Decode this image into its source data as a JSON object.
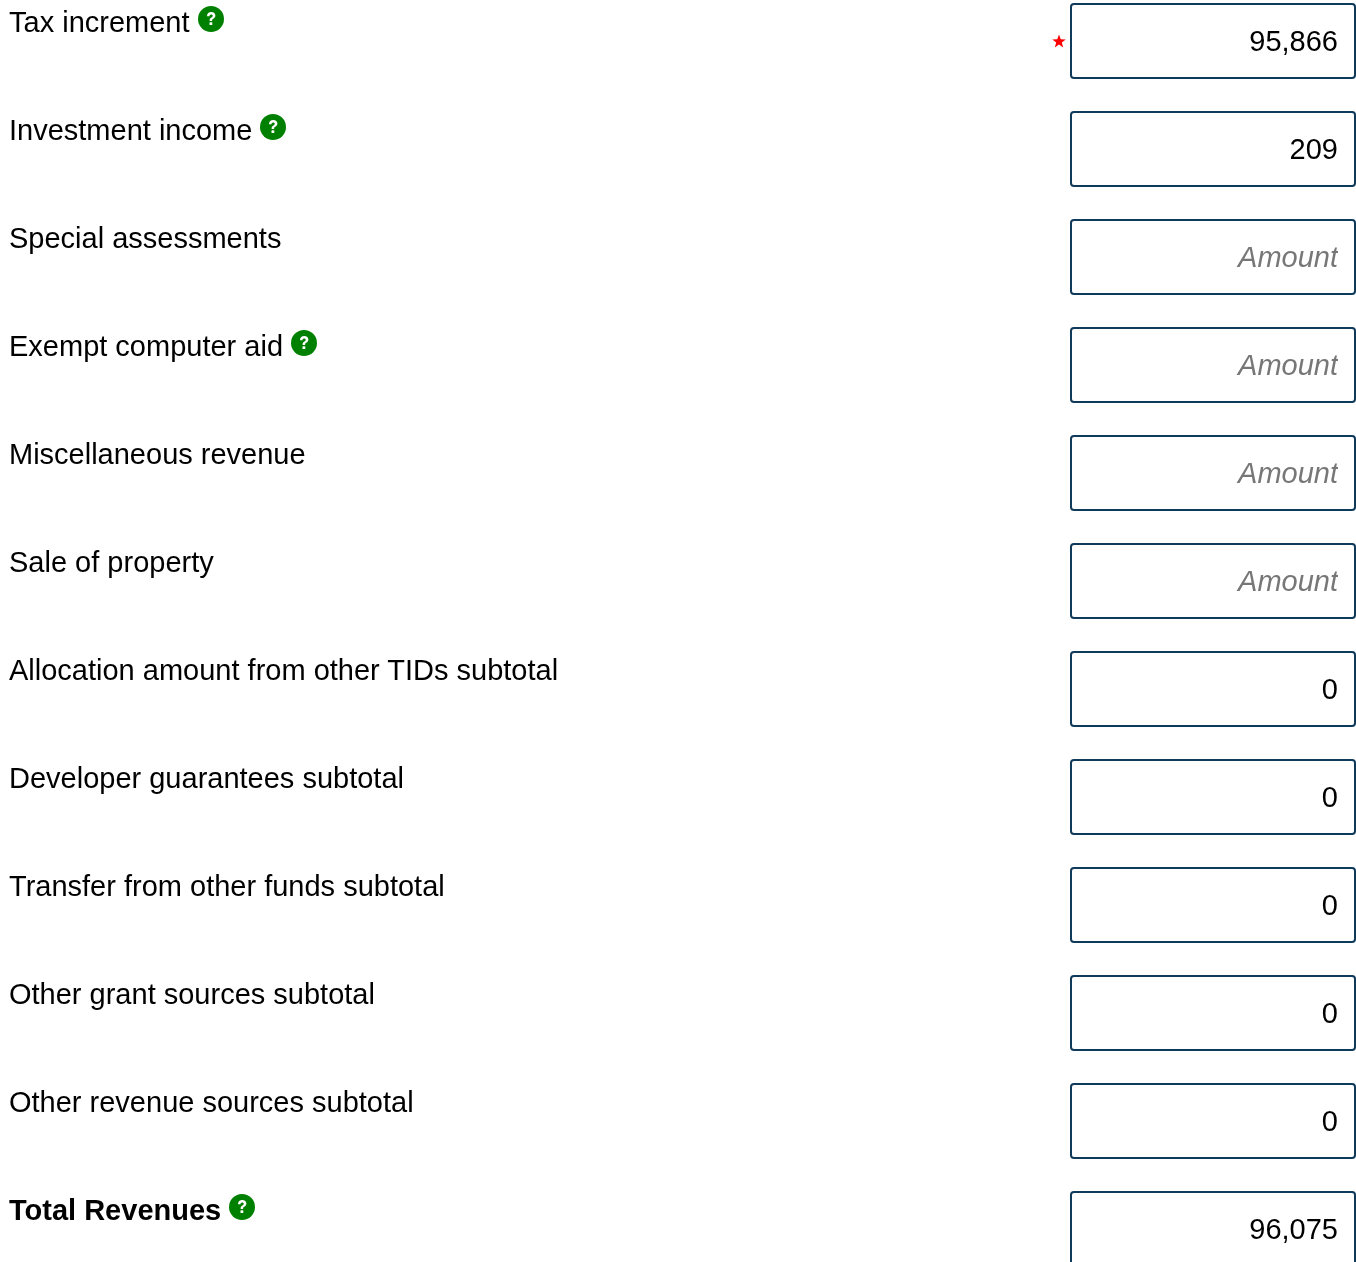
{
  "fields": [
    {
      "label": "Tax increment",
      "help": true,
      "required": true,
      "value": "95,866",
      "kind": "line"
    },
    {
      "label": "Investment income",
      "help": true,
      "required": false,
      "value": "209",
      "kind": "line"
    },
    {
      "label": "Special assessments",
      "help": false,
      "required": false,
      "placeholder": "Amount",
      "kind": "line"
    },
    {
      "label": "Exempt computer aid",
      "help": true,
      "required": false,
      "placeholder": "Amount",
      "kind": "line"
    },
    {
      "label": "Miscellaneous revenue",
      "help": false,
      "required": false,
      "placeholder": "Amount",
      "kind": "line"
    },
    {
      "label": "Sale of property",
      "help": false,
      "required": false,
      "placeholder": "Amount",
      "kind": "line"
    },
    {
      "label": "Allocation amount from other TIDs subtotal",
      "help": false,
      "required": false,
      "value": "0",
      "kind": "line"
    },
    {
      "label": "Developer guarantees subtotal",
      "help": false,
      "required": false,
      "value": "0",
      "kind": "line"
    },
    {
      "label": "Transfer from other funds subtotal",
      "help": false,
      "required": false,
      "value": "0",
      "kind": "line"
    },
    {
      "label": "Other grant sources subtotal",
      "help": false,
      "required": false,
      "value": "0",
      "kind": "line"
    },
    {
      "label": "Other revenue sources subtotal",
      "help": false,
      "required": false,
      "value": "0",
      "kind": "line"
    },
    {
      "label": "Total Revenues",
      "help": true,
      "required": false,
      "value": "96,075",
      "kind": "total"
    }
  ]
}
